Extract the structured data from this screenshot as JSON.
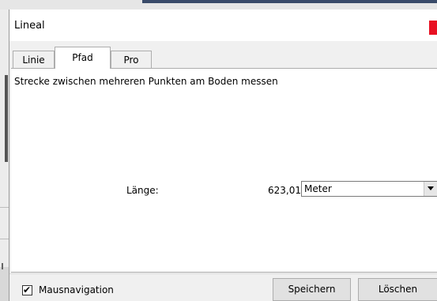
{
  "window": {
    "title": "Lineal"
  },
  "tabs": [
    {
      "label": "Linie"
    },
    {
      "label": "Pfad",
      "active": true
    },
    {
      "label": "Pro"
    }
  ],
  "panel": {
    "description": "Strecke zwischen mehreren Punkten am Boden messen",
    "length_label": "Länge:",
    "length_value": "623,01",
    "unit_selected": "Meter"
  },
  "footer": {
    "mouse_nav_label": "Mausnavigation",
    "mouse_nav_checked": true,
    "checkmark_glyph": "✔",
    "save_label": "Speichern",
    "delete_label": "Löschen"
  },
  "colors": {
    "close_button": "#e81123",
    "panel_bg": "#ffffff",
    "dialog_bg": "#f0f0f0"
  },
  "icons": {
    "close": "close-icon",
    "dropdown": "chevron-down-icon",
    "check": "check-icon"
  }
}
